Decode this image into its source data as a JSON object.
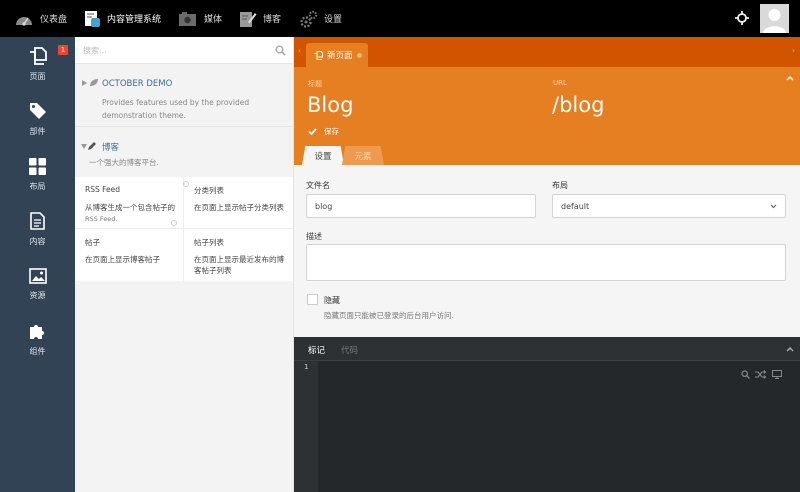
{
  "topbar": {
    "items": [
      {
        "label": "仪表盘",
        "icon": "dashboard-icon"
      },
      {
        "label": "内容管理系统",
        "icon": "cms-icon"
      },
      {
        "label": "媒体",
        "icon": "media-icon"
      },
      {
        "label": "博客",
        "icon": "blog-icon"
      },
      {
        "label": "设置",
        "icon": "settings-gear-icon"
      }
    ]
  },
  "sidebar": {
    "badge": "1",
    "items": [
      {
        "label": "页面",
        "icon": "pages-icon"
      },
      {
        "label": "部件",
        "icon": "partials-tag-icon"
      },
      {
        "label": "布局",
        "icon": "layouts-grid-icon"
      },
      {
        "label": "内容",
        "icon": "content-file-icon"
      },
      {
        "label": "资源",
        "icon": "assets-image-icon"
      },
      {
        "label": "组件",
        "icon": "components-puzzle-icon"
      }
    ]
  },
  "plugins": {
    "search_placeholder": "搜索...",
    "groups": [
      {
        "title": "OCTOBER DEMO",
        "description": "Provides features used by the provided demonstration theme."
      },
      {
        "title": "博客",
        "description": "一个强大的博客平台."
      }
    ],
    "components": [
      {
        "name": "RSS Feed",
        "desc": "从博客生成一个包含帖子的",
        "desc2": "RSS Feed."
      },
      {
        "name": "分类列表",
        "desc": "在页面上显示帖子分类列表",
        "desc2": ""
      },
      {
        "name": "帖子",
        "desc": "在页面上显示博客帖子",
        "desc2": ""
      },
      {
        "name": "帖子列表",
        "desc": "在页面上显示最近发布的博客帖子列表",
        "desc2": ""
      }
    ]
  },
  "editor": {
    "tab_label": "新页面",
    "title_label": "标题",
    "title_value": "Blog",
    "url_label": "URL",
    "url_value": "/blog",
    "save_label": "保存",
    "subtabs": [
      "设置",
      "元素"
    ],
    "form": {
      "file_label": "文件名",
      "file_value": "blog",
      "layout_label": "布局",
      "layout_value": "default",
      "desc_label": "描述",
      "desc_value": "",
      "hidden_label": "隐藏",
      "hidden_help": "隐藏页面只能被已登录的后台用户访问."
    },
    "code_tabs": [
      "标记",
      "代码"
    ],
    "line_number": "1"
  },
  "colors": {
    "accent": "#e67e22",
    "accent_dark": "#d35400",
    "sidebar": "#324356",
    "topbar": "#000000",
    "code_bg": "#2d3134"
  }
}
